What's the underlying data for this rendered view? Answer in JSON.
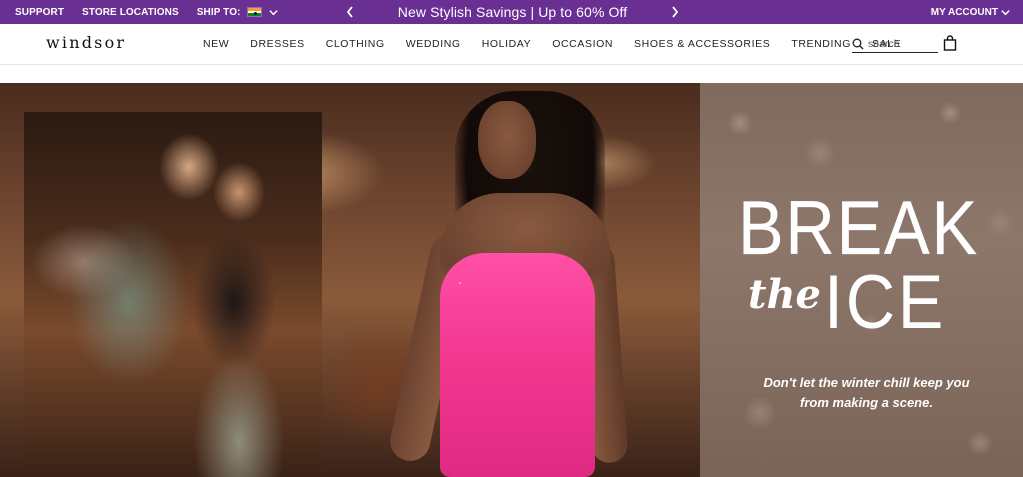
{
  "topbar": {
    "support": "SUPPORT",
    "store_locations": "STORE LOCATIONS",
    "ship_to": "SHIP TO:",
    "ship_to_flag": "india-flag-icon",
    "promo": "New Stylish Savings | Up to 60% Off",
    "my_account": "MY ACCOUNT",
    "background_color": "#6a2f93"
  },
  "header": {
    "logo": "windsor",
    "nav": [
      "NEW",
      "DRESSES",
      "CLOTHING",
      "WEDDING",
      "HOLIDAY",
      "OCCASION",
      "SHOES & ACCESSORIES",
      "TRENDING",
      "SALE"
    ],
    "search_placeholder": "search"
  },
  "hero": {
    "headline_line1": "BREAK",
    "headline_the": "the",
    "headline_ice": "ICE",
    "subtext": "Don't let the winter chill keep you from making a scene.",
    "dress_color": "#f2368f"
  }
}
